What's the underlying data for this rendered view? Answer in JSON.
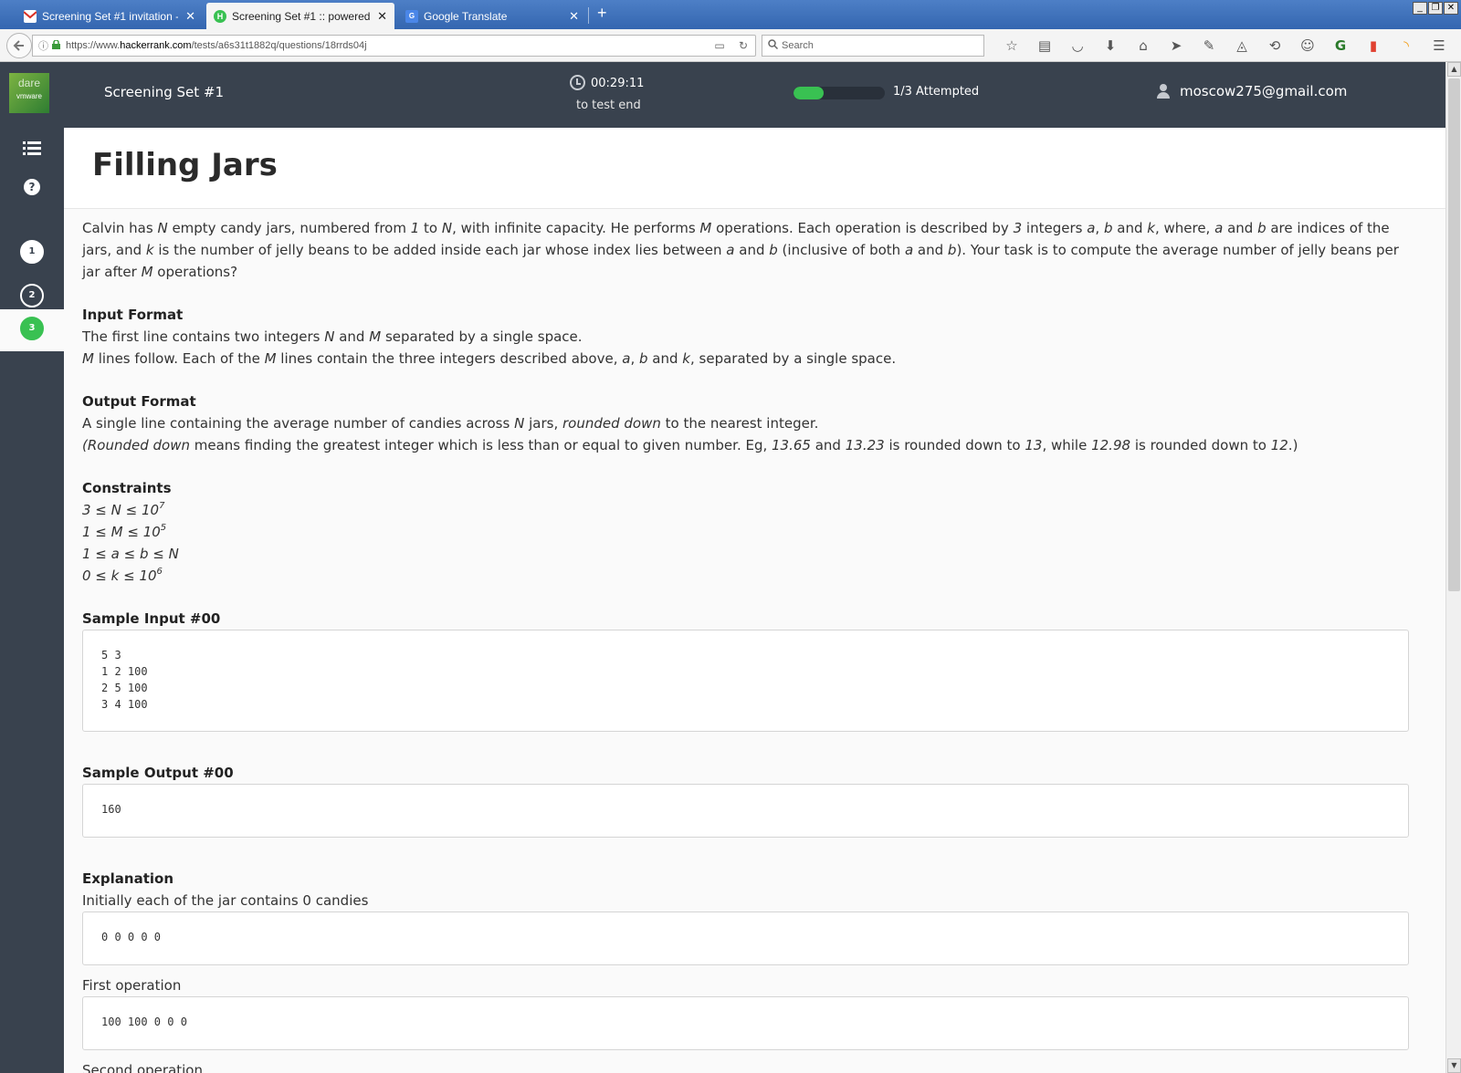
{
  "browser": {
    "tabs": [
      {
        "label": "Screening Set #1 invitation - ...",
        "favicon": "gmail-icon",
        "color": "#d93025"
      },
      {
        "label": "Screening Set #1 :: powered ...",
        "favicon": "hackerrank-icon",
        "color": "#39c152"
      },
      {
        "label": "Google Translate",
        "favicon": "google-translate-icon",
        "color": "#4a86e8"
      }
    ],
    "url_prefix": "https://www.",
    "url_domain": "hackerrank.com",
    "url_path": "/tests/a6s31t1882q/questions/18rrds04j",
    "search_placeholder": "Search",
    "toolbar_icons": [
      "bookmark-star-icon",
      "reading-list-icon",
      "pocket-icon",
      "download-icon",
      "home-icon",
      "send-icon",
      "extension-icon",
      "tracker-icon",
      "sync-icon",
      "emoji-icon",
      "grammarly-icon",
      "fire-icon",
      "rss-icon"
    ]
  },
  "header": {
    "logo_top": "dare",
    "logo_bottom": "vmware",
    "test_name": "Screening Set #1",
    "timer": "00:29:11",
    "timer_sub": "to test end",
    "progress": 0.33,
    "attempted": "1/3 Attempted",
    "user_email": "moscow275@gmail.com"
  },
  "sidebar": {
    "questions": [
      "1",
      "2",
      "3"
    ],
    "active_question": "3",
    "help_label": "?"
  },
  "question": {
    "title": "Filling Jars",
    "input_format_heading": "Input Format",
    "output_format_heading": "Output Format",
    "constraints_heading": "Constraints",
    "sample_input_heading": "Sample Input #00",
    "sample_input": "5 3\n1 2 100\n2 5 100\n3 4 100",
    "sample_output_heading": "Sample Output #00",
    "sample_output": "160",
    "explanation_heading": "Explanation",
    "explanation_line1": "Initially each of the jar contains 0 candies",
    "explanation_box1": "0 0 0 0 0",
    "explanation_line2": "First operation",
    "explanation_box2": "100 100 0 0 0",
    "explanation_line3": "Second operation"
  }
}
